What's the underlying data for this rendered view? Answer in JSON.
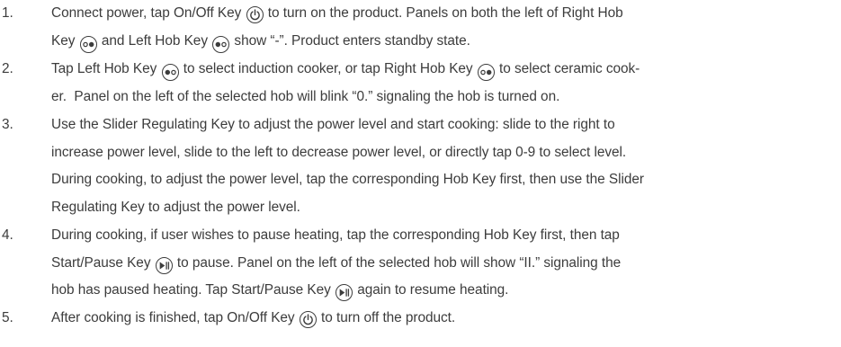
{
  "icons": {
    "power": "power-icon",
    "right_hob": "right-hob-icon",
    "left_hob": "left-hob-icon",
    "start_pause": "start-pause-icon"
  },
  "steps": [
    {
      "number": "1.",
      "lines": [
        [
          "Connect power, tap On/Off Key ",
          {
            "icon": "power"
          },
          " to turn on the product. Panels on both the left of Right Hob"
        ],
        [
          "Key ",
          {
            "icon": "right_hob"
          },
          " and Left Hob Key ",
          {
            "icon": "left_hob"
          },
          " show “-”. Product enters standby state."
        ]
      ]
    },
    {
      "number": "2.",
      "lines": [
        [
          "Tap Left Hob Key ",
          {
            "icon": "left_hob"
          },
          " to select induction cooker, or tap Right Hob Key ",
          {
            "icon": "right_hob"
          },
          " to select ceramic cook-"
        ],
        [
          "er.  Panel on the left of the selected hob will blink “0.” signaling the hob is turned on."
        ]
      ]
    },
    {
      "number": "3.",
      "lines": [
        [
          "Use the Slider Regulating Key to adjust the power level and start cooking: slide to the right to"
        ],
        [
          "increase power level, slide to the left to decrease power level, or directly tap 0-9 to select level."
        ],
        [
          "During cooking, to adjust the power level, tap the corresponding Hob Key first, then use the Slider"
        ],
        [
          "Regulating Key to adjust the power level."
        ]
      ]
    },
    {
      "number": "4.",
      "lines": [
        [
          "During cooking, if user wishes to pause heating, tap the corresponding Hob Key first, then tap"
        ],
        [
          "Start/Pause Key ",
          {
            "icon": "start_pause"
          },
          " to pause. Panel on the left of the selected hob will show “II.” signaling the"
        ],
        [
          "hob has paused heating. Tap Start/Pause Key ",
          {
            "icon": "start_pause"
          },
          " again to resume heating."
        ]
      ]
    },
    {
      "number": "5.",
      "lines": [
        [
          "After cooking is finished, tap On/Off Key ",
          {
            "icon": "power"
          },
          " to turn off the product."
        ]
      ]
    }
  ]
}
